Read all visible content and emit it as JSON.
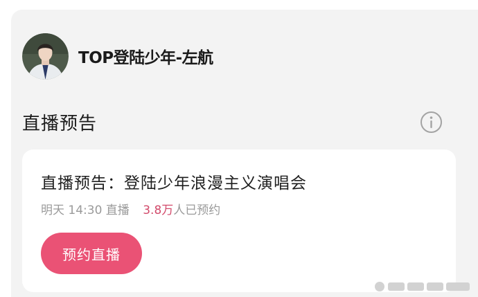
{
  "account": {
    "name": "TOP登陆少年-左航"
  },
  "section": {
    "title": "直播预告"
  },
  "card": {
    "title": "直播预告：登陆少年浪漫主义演唱会",
    "schedule": "明天 14:30 直播",
    "reserve_count": "3.8万",
    "reserve_suffix": "人已预约",
    "button_label": "预约直播"
  },
  "colors": {
    "accent": "#ea5275",
    "count_text": "#d24a6b",
    "panel_bg": "#f3f3f3",
    "card_bg": "#ffffff"
  },
  "icons": {
    "info": "info-circle-icon",
    "avatar": "user-avatar"
  }
}
